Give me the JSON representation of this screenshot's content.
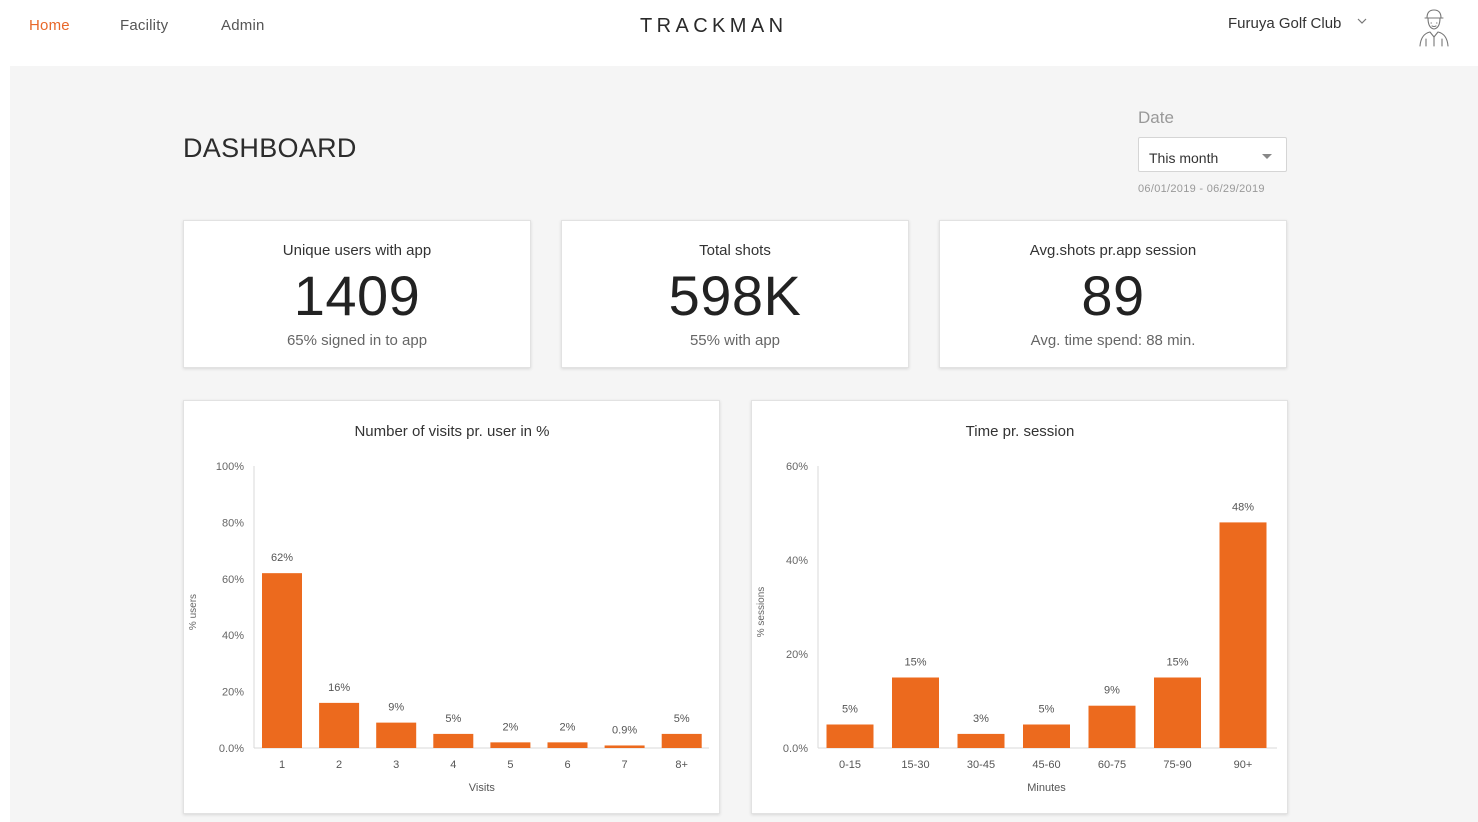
{
  "nav": {
    "items": [
      {
        "label": "Home",
        "active": true
      },
      {
        "label": "Facility",
        "active": false
      },
      {
        "label": "Admin",
        "active": false
      }
    ]
  },
  "brand": "TRACKMAN",
  "club": {
    "name": "Furuya Golf Club",
    "icon": "chevron-down-icon"
  },
  "user": {
    "icon": "golfer-avatar-icon"
  },
  "page": {
    "title": "DASHBOARD"
  },
  "date": {
    "label": "Date",
    "selected": "This month",
    "range": "06/01/2019 - 06/29/2019"
  },
  "stats": [
    {
      "title": "Unique users with app",
      "value": "1409",
      "sub": "65% signed in to app"
    },
    {
      "title": "Total shots",
      "value": "598K",
      "sub": "55% with app"
    },
    {
      "title": "Avg.shots pr.app session",
      "value": "89",
      "sub": "Avg. time spend: 88 min."
    }
  ],
  "colors": {
    "accent": "#e8682a",
    "bar": "#ec6a1e"
  },
  "chart_data": [
    {
      "type": "bar",
      "title": "Number of visits pr. user in %",
      "xlabel": "Visits",
      "ylabel": "% users",
      "categories": [
        "1",
        "2",
        "3",
        "4",
        "5",
        "6",
        "7",
        "8+"
      ],
      "values": [
        62,
        16,
        9,
        5,
        2,
        2,
        0.9,
        5
      ],
      "value_labels": [
        "62%",
        "16%",
        "9%",
        "5%",
        "2%",
        "2%",
        "0.9%",
        "5%"
      ],
      "yticks": [
        "0.0%",
        "20%",
        "40%",
        "60%",
        "80%",
        "100%"
      ],
      "ylim": [
        0,
        100
      ],
      "grid": false
    },
    {
      "type": "bar",
      "title": "Time pr. session",
      "xlabel": "Minutes",
      "ylabel": "% sessions",
      "categories": [
        "0-15",
        "15-30",
        "30-45",
        "45-60",
        "60-75",
        "75-90",
        "90+"
      ],
      "values": [
        5,
        15,
        3,
        5,
        9,
        15,
        48
      ],
      "value_labels": [
        "5%",
        "15%",
        "3%",
        "5%",
        "9%",
        "15%",
        "48%"
      ],
      "yticks": [
        "0.0%",
        "20%",
        "40%",
        "60%"
      ],
      "ylim": [
        0,
        60
      ],
      "grid": false
    }
  ]
}
